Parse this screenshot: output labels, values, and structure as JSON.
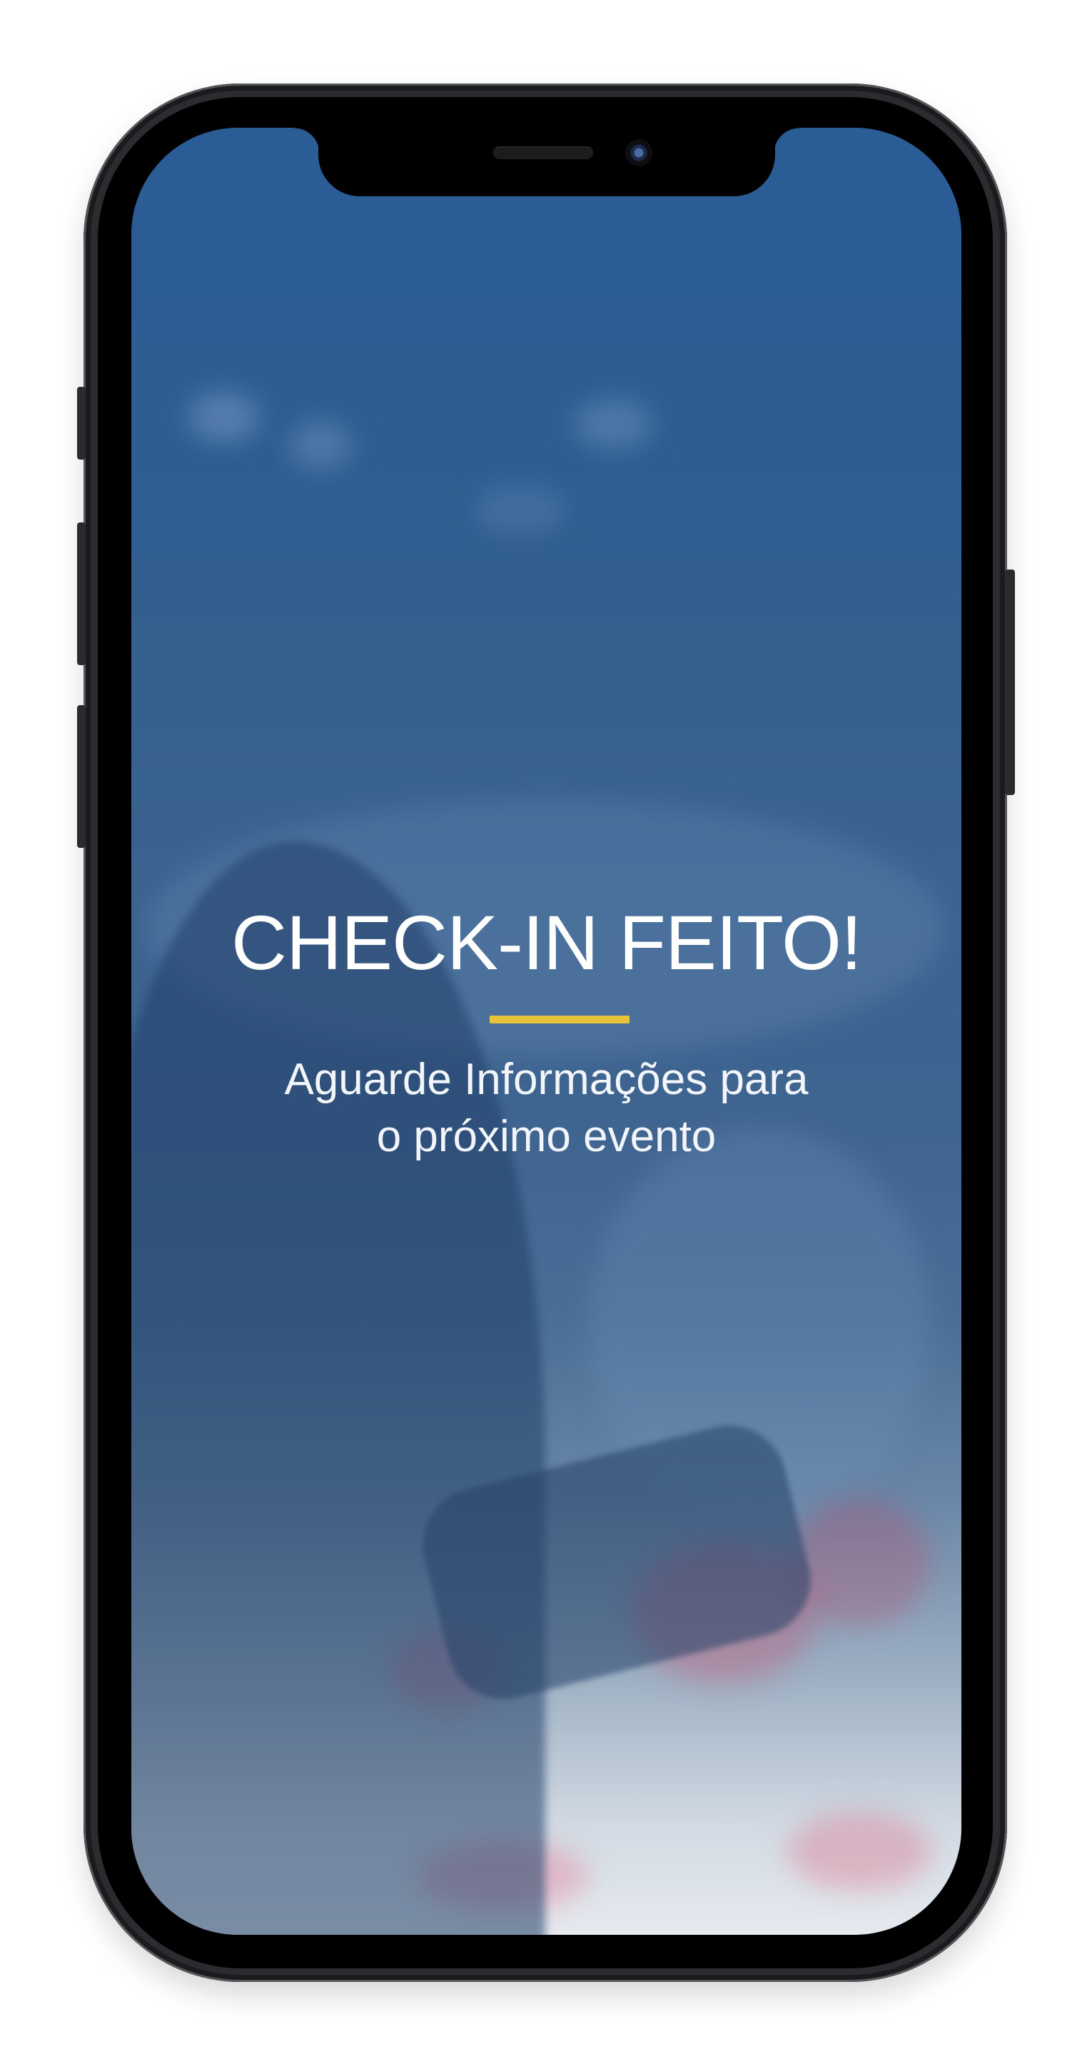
{
  "screen": {
    "title": "CHECK-IN FEITO!",
    "subtitle_line1": "Aguarde Informações para",
    "subtitle_line2": "o próximo evento"
  },
  "colors": {
    "accent": "#e8c33a",
    "text": "#ffffff",
    "overlay_blue": "#2d5a8f"
  },
  "background": {
    "image": "blurred-conference-speaker-photo"
  }
}
